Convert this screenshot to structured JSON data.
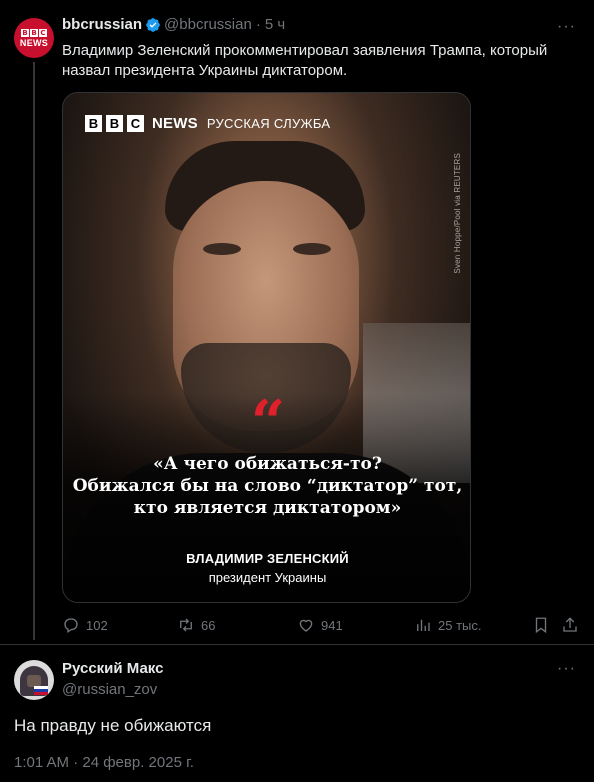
{
  "tweet": {
    "author_name": "bbcrussian",
    "handle": "@bbcrussian",
    "time": "5 ч",
    "text": "Владимир Зеленский прокомментировал заявления Трампа, который назвал президента Украины диктатором.",
    "avatar": {
      "brand_blocks": [
        "B",
        "B",
        "C"
      ],
      "brand_word": "NEWS"
    },
    "verified_color": "#1d9bf0"
  },
  "media": {
    "brand_blocks": [
      "B",
      "B",
      "C"
    ],
    "brand_news": "NEWS",
    "service": "РУССКАЯ СЛУЖБА",
    "credit": "Sven Hoppe/Pool via REUTERS",
    "quote_mark": "“",
    "quote_lines": [
      "«А чего обижаться-то?",
      "Обижался бы на слово “диктатор” тот,",
      "кто является диктатором»"
    ],
    "speaker_name": "ВЛАДИМИР ЗЕЛЕНСКИЙ",
    "speaker_role": "президент Украины",
    "accent_color": "#e0202a"
  },
  "actions": {
    "replies": "102",
    "reposts": "66",
    "likes": "941",
    "views": "25 тыс."
  },
  "reply": {
    "author_name": "Русский Макс",
    "handle": "@russian_zov",
    "text": "На правду не обижаются",
    "timestamp": "1:01 AM · 24 февр. 2025 г."
  }
}
